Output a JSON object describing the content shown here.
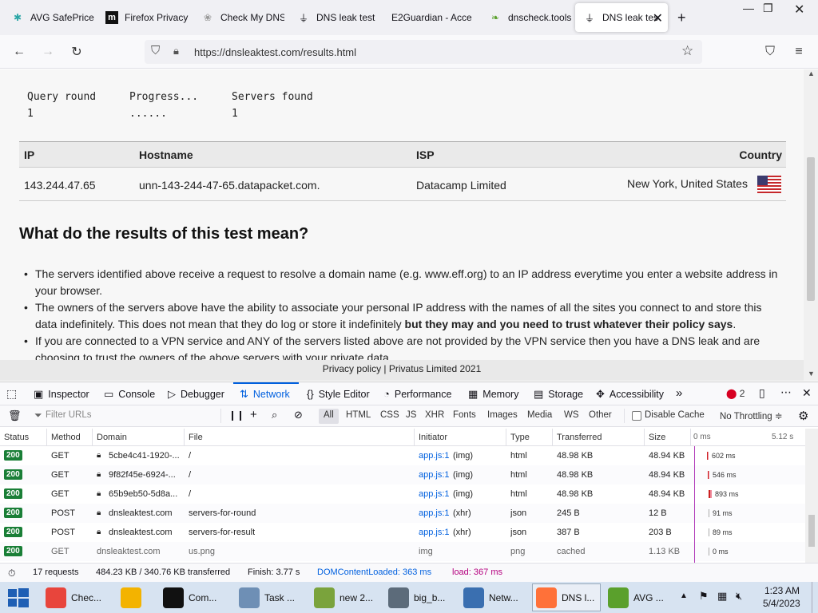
{
  "tabs": [
    {
      "label": "AVG SafePrice",
      "icon": "avg-icon"
    },
    {
      "label": "Firefox Privacy",
      "icon": "mozilla-icon"
    },
    {
      "label": "Check My DNS",
      "icon": "dns-check-icon"
    },
    {
      "label": "DNS leak test",
      "icon": "dnsleak-icon"
    },
    {
      "label": "E2Guardian - Acce",
      "icon": "none"
    },
    {
      "label": "dnscheck.tools",
      "icon": "leaf-icon"
    },
    {
      "label": "DNS leak tes",
      "icon": "dnsleak-icon"
    }
  ],
  "newtab": "+",
  "url": "https://dnsleaktest.com/results.html",
  "query": {
    "h1": "Query round",
    "h2": "Progress...",
    "h3": "Servers found",
    "v1": "1",
    "v2": "......",
    "v3": "1"
  },
  "table": {
    "headers": [
      "IP",
      "Hostname",
      "ISP",
      "Country"
    ],
    "row": {
      "ip": "143.244.47.65",
      "host": "unn-143-244-47-65.datapacket.com.",
      "isp": "Datacamp Limited",
      "country": "New York, United States"
    }
  },
  "section_title": "What do the results of this test mean?",
  "bullets": [
    {
      "text": "The servers identified above receive a request to resolve a domain name (e.g. www.eff.org) to an IP address everytime you enter a website address in your browser."
    },
    {
      "text": "The owners of the servers above have the ability to associate your personal IP address with the names of all the sites you connect to and store this data indefinitely. This does not mean that they do log or store it indefinitely ",
      "bold": "but they may and you need to trust whatever their policy says",
      "end": "."
    },
    {
      "text": "If you are connected to a VPN service and ANY of the servers listed above are not provided by the VPN service then you have a DNS leak and are choosing to trust the owners of the above servers with your private data."
    }
  ],
  "footer": "Privacy policy | Privatus Limited 2021",
  "devtools": {
    "tabs": [
      "Inspector",
      "Console",
      "Debugger",
      "Network",
      "Style Editor",
      "Performance",
      "Memory",
      "Storage",
      "Accessibility"
    ],
    "error_count": "2",
    "filter_placeholder": "Filter URLs",
    "types": [
      "All",
      "HTML",
      "CSS",
      "JS",
      "XHR",
      "Fonts",
      "Images",
      "Media",
      "WS",
      "Other"
    ],
    "disable_cache": "Disable Cache",
    "throttling": "No Throttling ≑",
    "columns": [
      "Status",
      "Method",
      "Domain",
      "File",
      "Initiator",
      "Type",
      "Transferred",
      "Size"
    ],
    "wf_start": "0 ms",
    "wf_end": "5.12 s",
    "rows": [
      {
        "status": "200",
        "method": "GET",
        "domain": "5cbe4c41-1920-...",
        "file": "/",
        "init": "app.js:1",
        "initx": "(img)",
        "type": "html",
        "transferred": "48.98 KB",
        "size": "48.94 KB",
        "time": "602 ms",
        "wf": 0.02
      },
      {
        "status": "200",
        "method": "GET",
        "domain": "9f82f45e-6924-...",
        "file": "/",
        "init": "app.js:1",
        "initx": "(img)",
        "type": "html",
        "transferred": "48.98 KB",
        "size": "48.94 KB",
        "time": "546 ms",
        "wf": 0.03
      },
      {
        "status": "200",
        "method": "GET",
        "domain": "65b9eb50-5d8a...",
        "file": "/",
        "init": "app.js:1",
        "initx": "(img)",
        "type": "html",
        "transferred": "48.98 KB",
        "size": "48.94 KB",
        "time": "893 ms",
        "wf": 0.04
      },
      {
        "status": "200",
        "method": "POST",
        "domain": "dnsleaktest.com",
        "file": "servers-for-round",
        "init": "app.js:1",
        "initx": "(xhr)",
        "type": "json",
        "transferred": "245 B",
        "size": "12 B",
        "time": "91 ms",
        "wf": 0.05
      },
      {
        "status": "200",
        "method": "POST",
        "domain": "dnsleaktest.com",
        "file": "servers-for-result",
        "init": "app.js:1",
        "initx": "(xhr)",
        "type": "json",
        "transferred": "387 B",
        "size": "203 B",
        "time": "89 ms",
        "wf": 0.05
      },
      {
        "status": "200",
        "method": "GET",
        "domain": "dnsleaktest.com",
        "file": "us.png",
        "init": "img",
        "initx": "",
        "type": "png",
        "transferred": "cached",
        "size": "1.13 KB",
        "time": "0 ms",
        "wf": 0.05
      }
    ],
    "status": {
      "requests": "17 requests",
      "size": "484.23 KB / 340.76 KB transferred",
      "finish": "Finish: 3.77 s",
      "dcl": "DOMContentLoaded: 363 ms",
      "load": "load: 367 ms"
    }
  },
  "taskbar": [
    {
      "label": "Chec...",
      "color": "#e8453c"
    },
    {
      "label": "",
      "color": "#f3b300"
    },
    {
      "label": "Com...",
      "color": "#111111"
    },
    {
      "label": "Task ...",
      "color": "#6e8fb5"
    },
    {
      "label": "new 2...",
      "color": "#7aa33c"
    },
    {
      "label": "big_b...",
      "color": "#5c6b7a"
    },
    {
      "label": "Netw...",
      "color": "#3a6fb0"
    },
    {
      "label": "DNS l...",
      "color": "#ff7139"
    },
    {
      "label": "AVG ...",
      "color": "#5aa02c"
    }
  ],
  "clock": {
    "time": "1:23 AM",
    "date": "5/4/2023"
  },
  "colors": {
    "accent": "#0060df",
    "ok": "#1a7f37"
  }
}
